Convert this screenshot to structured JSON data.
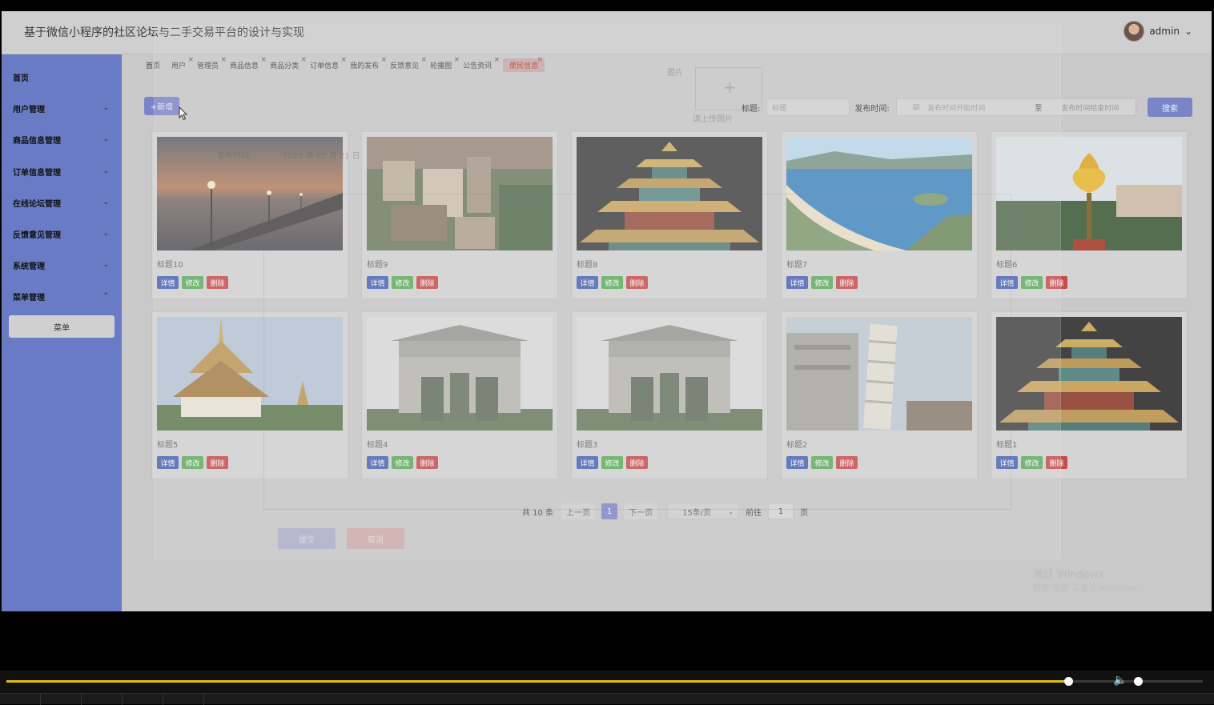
{
  "app": {
    "title": "基于微信小程序的社区论坛与二手交易平台的设计与实现",
    "user_name": "admin",
    "user_chevron": "⌄"
  },
  "sidebar": {
    "items": [
      {
        "label": "首页",
        "chevron": ""
      },
      {
        "label": "用户管理",
        "chevron": "⌄"
      },
      {
        "label": "商品信息管理",
        "chevron": "⌄"
      },
      {
        "label": "订单信息管理",
        "chevron": "⌄"
      },
      {
        "label": "在线论坛管理",
        "chevron": "⌄"
      },
      {
        "label": "反馈意见管理",
        "chevron": "⌄"
      },
      {
        "label": "系统管理",
        "chevron": "⌄"
      },
      {
        "label": "菜单管理",
        "chevron": "⌃"
      }
    ],
    "submenu": "菜单"
  },
  "tabs": [
    {
      "label": "首页",
      "closable": false,
      "active": false
    },
    {
      "label": "用户",
      "closable": true,
      "active": false
    },
    {
      "label": "管理员",
      "closable": true,
      "active": false
    },
    {
      "label": "商品信息",
      "closable": true,
      "active": false
    },
    {
      "label": "商品分类",
      "closable": true,
      "active": false
    },
    {
      "label": "订单信息",
      "closable": true,
      "active": false
    },
    {
      "label": "我的发布",
      "closable": true,
      "active": false
    },
    {
      "label": "反馈意见",
      "closable": true,
      "active": false
    },
    {
      "label": "轮播图",
      "closable": true,
      "active": false
    },
    {
      "label": "公告资讯",
      "closable": true,
      "active": false
    },
    {
      "label": "便民信息",
      "closable": true,
      "active": true
    }
  ],
  "toolbar": {
    "add_label": "+新增",
    "title_label": "标题:",
    "title_placeholder": "标题",
    "time_label": "发布时间:",
    "time_start_placeholder": "发布时间开始时间",
    "time_separator": "至",
    "time_end_placeholder": "发布时间结束时间",
    "search_label": "搜索"
  },
  "cards": [
    {
      "title": "标题10",
      "image": "sunset-pier"
    },
    {
      "title": "标题9",
      "image": "cliff-village"
    },
    {
      "title": "标题8",
      "image": "pagoda-night"
    },
    {
      "title": "标题7",
      "image": "coast-bay"
    },
    {
      "title": "标题6",
      "image": "golden-lotus"
    },
    {
      "title": "标题5",
      "image": "thai-temple"
    },
    {
      "title": "标题4",
      "image": "stone-gate"
    },
    {
      "title": "标题3",
      "image": "stone-gate"
    },
    {
      "title": "标题2",
      "image": "leaning-tower"
    },
    {
      "title": "标题1",
      "image": "pagoda-night"
    }
  ],
  "card_buttons": {
    "detail": "详情",
    "edit": "修改",
    "delete": "删除"
  },
  "pagination": {
    "total": "共 10 条",
    "prev": "上一页",
    "current_page": "1",
    "next": "下一页",
    "page_size": "15条/页",
    "goto_label": "前往",
    "goto_value": "1",
    "page_unit": "页"
  },
  "ghost": {
    "image_label": "图片",
    "upload_hint": "请上传图片",
    "time_label": "发布时间",
    "time_value": "2025 年 02 月 21 日",
    "submit": "提交",
    "cancel": "取消"
  },
  "watermark": {
    "line1": "激活 Windows",
    "line2": "转到\"设置\"以激活 Windows。"
  },
  "player": {
    "progress": 0.89,
    "volume": 0.04,
    "accent_color": "#e2c012"
  }
}
